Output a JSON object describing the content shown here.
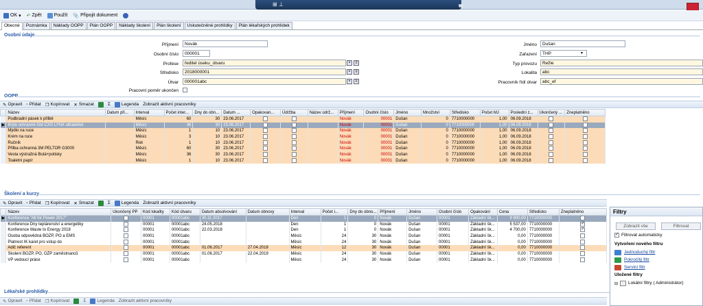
{
  "window": {
    "title_icons": "⊞ ⊥",
    "min": "−",
    "restore": "⧉",
    "close": "×"
  },
  "toolbar": {
    "ok": "OK",
    "back": "Zpět",
    "use": "Použít",
    "attach": "Připojit dokument"
  },
  "tabs": [
    "Obecné",
    "Poznámka",
    "Náklady OOPP",
    "Plán OOPP",
    "Náklady školení",
    "Plán školení",
    "Uskutečněné prohlídky",
    "Plán lékařských prohlídek"
  ],
  "personal": {
    "section": "Osobní údaje",
    "labels": {
      "prijmeni": "Příjmení",
      "osobni_cislo": "Osobní číslo",
      "profese": "Profese",
      "stredisko": "Středisko",
      "utvar": "Útvar",
      "pracovni_pomer": "Pracovní poměr ukončen",
      "jmeno": "Jméno",
      "zarazeni": "Zařazení",
      "typ_provozu": "Typ provozu",
      "lokalita": "Lokalita",
      "pracovnik_ridi": "Pracovník řídí útvar"
    },
    "values": {
      "prijmeni": "Novák",
      "osobni_cislo": "000001",
      "profese": "ředitel úseku_útvaru",
      "stredisko": "2018000001",
      "utvar": "000001abc",
      "jmeno": "Dušan",
      "zarazeni": "THP",
      "typ_provozu": "Režie",
      "lokalita": "abc",
      "pracovnik_ridi": "abc_ef"
    }
  },
  "oopp": {
    "section": "OOPP",
    "toolbar": {
      "edit": "Opravit",
      "add": "Přidat",
      "copy": "Kopírovat",
      "delete": "Smazat",
      "legend": "Legenda",
      "show_active": "Zobrazit aktivní pracovníky"
    },
    "columns": [
      "Název",
      "Datum při...",
      "Interval",
      "Počet inter...",
      "Dny do obn...",
      "Datum ...",
      "Opakovan...",
      "Údržba",
      "Název údrž...",
      "Příjmení",
      "Osobní číslo",
      "Jméno",
      "Množství",
      "Středisko",
      "Počet MJ",
      "Poslední z...",
      "Ukončený ...",
      "Zneplatněno"
    ],
    "rows": [
      [
        "Podbradní pásek k přilbě",
        "",
        "Měsíc",
        "60",
        "30",
        "23.06.2017",
        "",
        "",
        "",
        "Novák",
        "00001",
        "Dušan",
        "0",
        "7710000000",
        "1,00",
        "06.09.2018",
        "",
        ""
      ],
      [
        "Brýle ochranné čiré CXS LYNX ultralehké",
        "",
        "Měsíc",
        "36",
        "30",
        "23.06.2017",
        "",
        "",
        "",
        "Novák",
        "00001",
        "Dušan",
        "0",
        "7710000000",
        "1,00",
        "06.09.2018",
        "",
        ""
      ],
      [
        "Mýdlo na ruce",
        "",
        "Měsíc",
        "1",
        "10",
        "23.06.2017",
        "",
        "",
        "",
        "Novák",
        "00001",
        "Dušan",
        "0",
        "7710000000",
        "1,00",
        "06.09.2018",
        "",
        ""
      ],
      [
        "Krém na ruce",
        "",
        "Měsíc",
        "3",
        "10",
        "23.06.2017",
        "",
        "",
        "",
        "Novák",
        "00001",
        "Dušan",
        "0",
        "7710000000",
        "1,00",
        "06.09.2018",
        "",
        ""
      ],
      [
        "Ručník",
        "",
        "Rok",
        "1",
        "10",
        "23.06.2017",
        "",
        "",
        "",
        "Novák",
        "00001",
        "Dušan",
        "0",
        "7710000000",
        "1,00",
        "06.09.2018",
        "",
        ""
      ],
      [
        "Přilba ochranná 3M PELTOR G3000",
        "",
        "Měsíc",
        "60",
        "30",
        "23.06.2017",
        "",
        "",
        "",
        "Novák",
        "00001",
        "Dušan",
        "0",
        "7710000000",
        "1,00",
        "06.09.2018",
        "",
        ""
      ],
      [
        "Vesta výstražná Butá+potisky",
        "",
        "Měsíc",
        "36",
        "30",
        "23.06.2017",
        "",
        "",
        "",
        "Novák",
        "00001",
        "Dušan",
        "0",
        "7710000000",
        "1,00",
        "06.09.2018",
        "",
        ""
      ],
      [
        "Toaletní papír",
        "",
        "Měsíc",
        "1",
        "10",
        "23.06.2017",
        "",
        "",
        "",
        "Novák",
        "00001",
        "Dušan",
        "0",
        "7710000000",
        "1,00",
        "06.09.2018",
        "",
        ""
      ]
    ]
  },
  "training": {
    "section": "Školení a kurzy",
    "toolbar": {
      "edit": "Opravit",
      "add": "Přidat",
      "copy": "Kopírovat",
      "delete": "Smazat",
      "legend": "Legenda",
      "show_active": "Zobrazit aktivní pracovníky"
    },
    "columns": [
      "Název",
      "Ukončený PP",
      "Kód lokality",
      "Kód útvaru",
      "Datum absolvování",
      "Datum obnovy",
      "Interval",
      "Počet i...",
      "Dny do obno...",
      "Příjmení",
      "Jméno",
      "Osobní číslo",
      "Opakování",
      "Cena",
      "Středisko",
      "Zneplatněno"
    ],
    "rows": [
      [
        "Konference \"All for Power 2017\"",
        "",
        "00001",
        "00001abc",
        "30.11.2017",
        "",
        "Den",
        "1",
        "0",
        "Novák",
        "Dušan",
        "00001",
        "Základní šk...",
        "9 900,00",
        "7710000000",
        "✓"
      ],
      [
        "Konference Dny teplárenství a energetiky",
        "",
        "00001",
        "00001abc",
        "24.05.2018",
        "",
        "Den",
        "1",
        "0",
        "Novák",
        "Dušan",
        "00001",
        "Základní šk...",
        "5 537,00",
        "7710000000",
        "✓"
      ],
      [
        "Konference Waste to Energy 2018",
        "",
        "00001",
        "00001abc",
        "22.03.2018",
        "",
        "Den",
        "1",
        "0",
        "Novák",
        "Dušan",
        "00001",
        "Základní šk...",
        "4 700,00",
        "7710000000",
        "✓"
      ],
      [
        "Osoba odpovědná BOZP, PO a EMS",
        "",
        "00001",
        "00001abc",
        "",
        "",
        "Měsíc",
        "24",
        "30",
        "Novák",
        "Dušan",
        "00001",
        "Základní šk...",
        "0,00",
        "7710000000",
        ""
      ],
      [
        "Platnost IK karet pro vstup do",
        "",
        "00001",
        "00001abc",
        "",
        "",
        "Měsíc",
        "24",
        "30",
        "Novák",
        "Dušan",
        "00001",
        "Základní šk...",
        "0,00",
        "7710000000",
        ""
      ],
      [
        "Adič referent",
        "",
        "00001",
        "00001abc",
        "01.06.2017",
        "27.04.2018",
        "Měsíc",
        "12",
        "30",
        "Novák",
        "Dušan",
        "00001",
        "Základní šk...",
        "0,00",
        "7710000000",
        ""
      ],
      [
        "Školení BOZP, PO, OŽP zaměstnanců",
        "",
        "00001",
        "00001abc",
        "01.06.2017",
        "22.04.2019",
        "Měsíc",
        "24",
        "30",
        "Novák",
        "Dušan",
        "00001",
        "Základní šk...",
        "0,00",
        "7710000000",
        ""
      ],
      [
        "VP vedoucí práce",
        "",
        "00001",
        "00001abc",
        "",
        "",
        "Měsíc",
        "24",
        "30",
        "Novák",
        "Dušan",
        "00001",
        "Základní šk...",
        "0,00",
        "7710000000",
        ""
      ]
    ]
  },
  "medical": {
    "section": "Lékařské prohlídky",
    "toolbar": {
      "edit": "Opravit",
      "add": "Přidat",
      "copy": "Kopírovat",
      "legend": "Legenda",
      "show_active": "Zobrazit aktivní pracovníky"
    }
  },
  "filters": {
    "title": "Filtry",
    "show_all": "Zobrazit vše",
    "filter": "Filtrovat",
    "auto": "Filtrovat automaticky",
    "create_section": "Vytvoření nového filtru",
    "simple": "Jednoduchý filtr",
    "advanced": "Pokročilý filtr",
    "server": "Serviní filtr",
    "saved_section": "Uložené filtry",
    "local": "Lokální filtry ( Administrátor)"
  },
  "colors": {
    "accent": "#2a5ba8",
    "orange_row": "#fcdcb8",
    "selected_row": "#9aa9bd"
  }
}
